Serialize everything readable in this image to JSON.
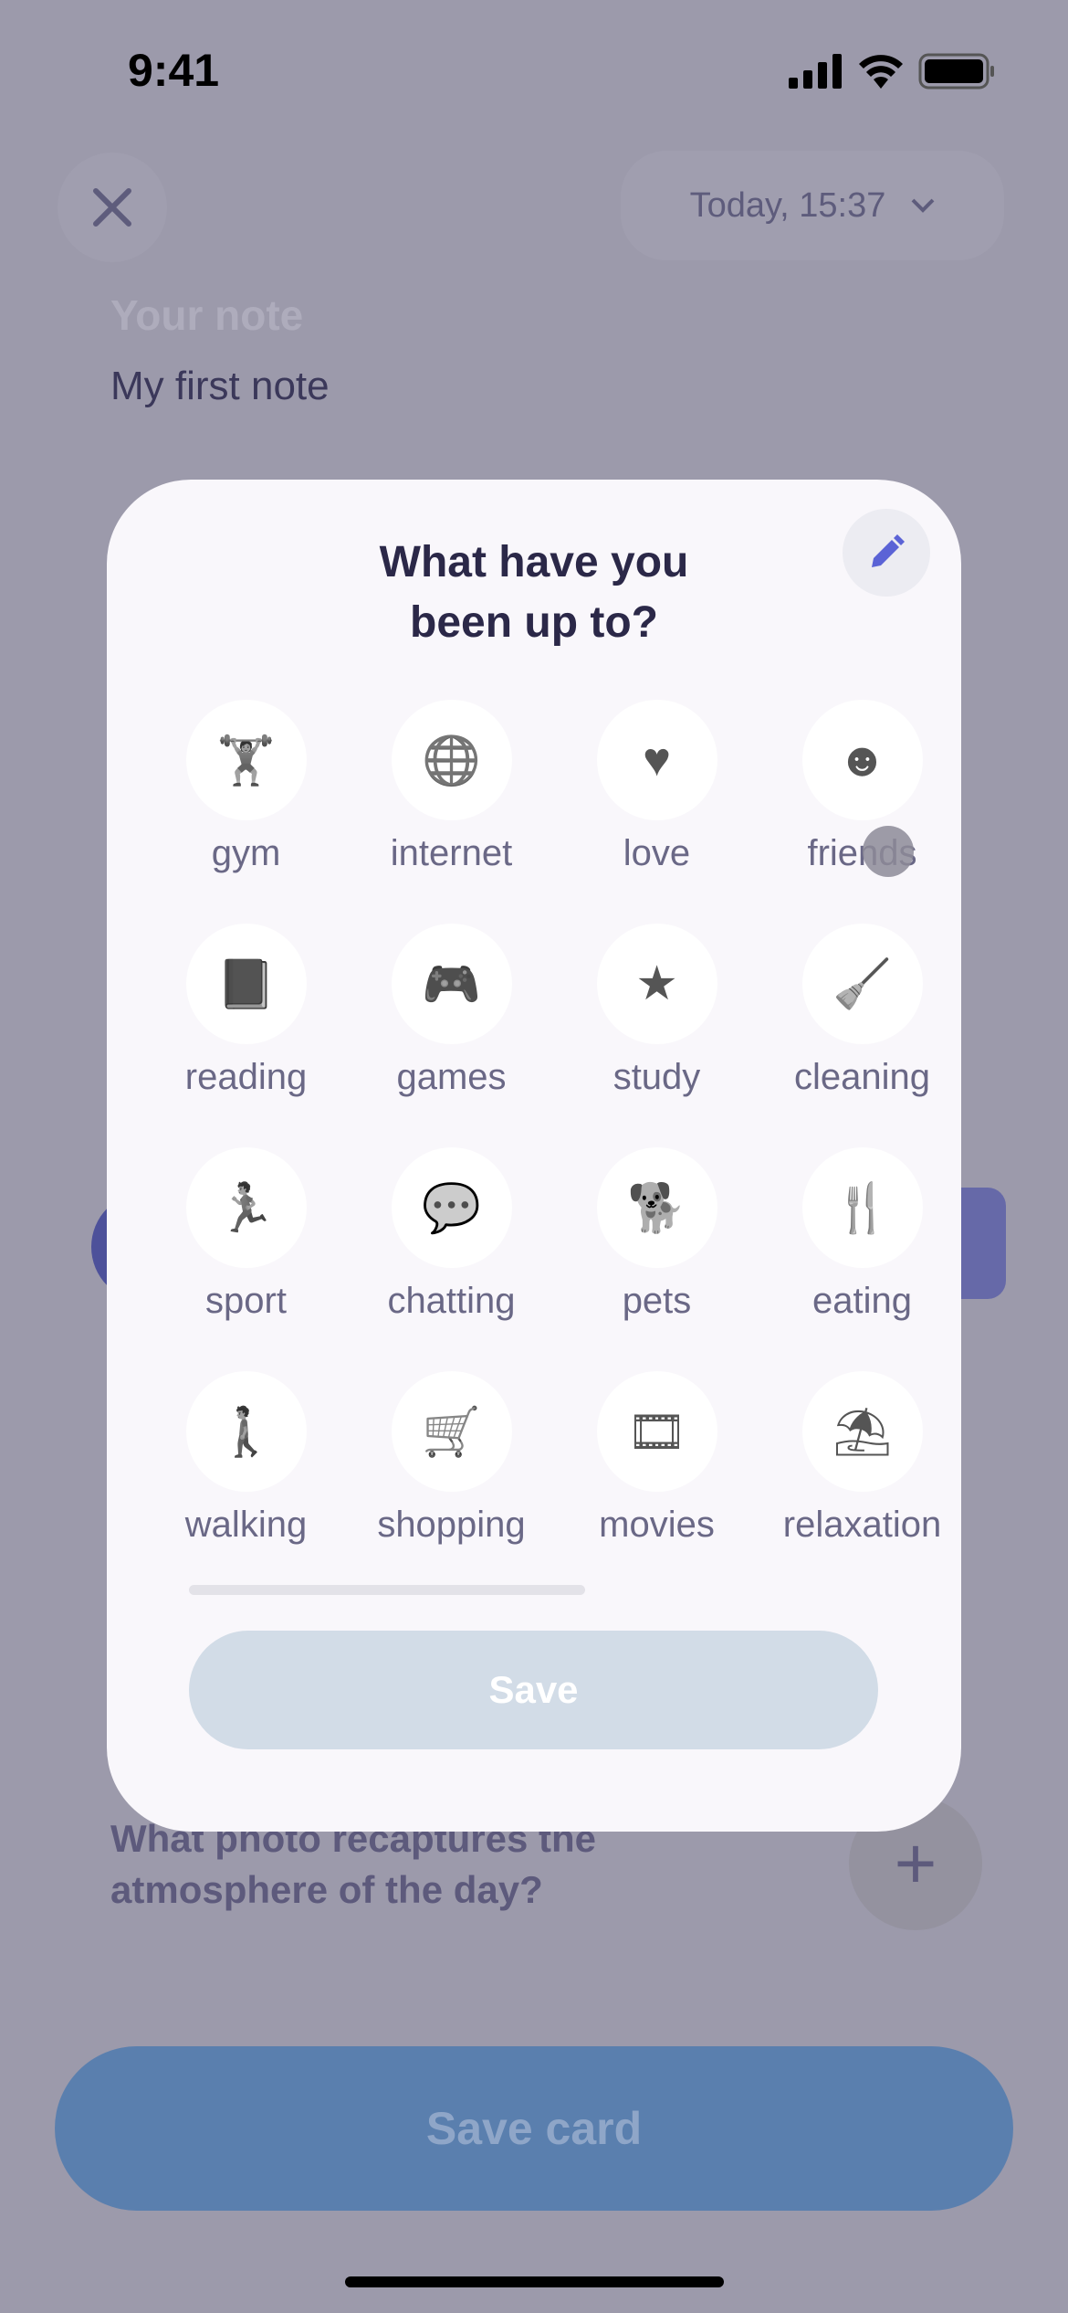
{
  "status_bar": {
    "time": "9:41",
    "icons": [
      "signal-icon",
      "wifi-icon",
      "battery-icon"
    ]
  },
  "header": {
    "close_icon": "close-icon",
    "date": "Today, 15:37",
    "date_icon": "chevron-down-icon"
  },
  "note": {
    "label": "Your note",
    "value": "My first note"
  },
  "background": {
    "photo_question": "What photo recaptures the atmosphere of the day?",
    "save_card": "Save card"
  },
  "modal": {
    "title": "What have you been up to?",
    "edit_icon": "pencil-icon",
    "activities": [
      {
        "label": "gym",
        "icon": "weightlifter-icon"
      },
      {
        "label": "internet",
        "icon": "globe-icon"
      },
      {
        "label": "love",
        "icon": "heart-icon"
      },
      {
        "label": "friends",
        "icon": "faces-icon"
      },
      {
        "label": "reading",
        "icon": "book-icon"
      },
      {
        "label": "games",
        "icon": "gamepad-icon"
      },
      {
        "label": "study",
        "icon": "study-book-icon"
      },
      {
        "label": "cleaning",
        "icon": "bucket-broom-icon"
      },
      {
        "label": "sport",
        "icon": "runner-icon"
      },
      {
        "label": "chatting",
        "icon": "phone-chat-icon"
      },
      {
        "label": "pets",
        "icon": "dog-cat-icon"
      },
      {
        "label": "eating",
        "icon": "plate-fork-knife-icon"
      },
      {
        "label": "walking",
        "icon": "walker-icon"
      },
      {
        "label": "shopping",
        "icon": "cart-icon"
      },
      {
        "label": "movies",
        "icon": "film-reel-icon"
      },
      {
        "label": "relaxation",
        "icon": "beach-umbrella-icon"
      }
    ],
    "save": "Save"
  },
  "colors": {
    "icon": "#6a6886",
    "save_disabled": "#d2dce7",
    "save_card": "#5a7fae",
    "overlay": "#9c9aab"
  }
}
